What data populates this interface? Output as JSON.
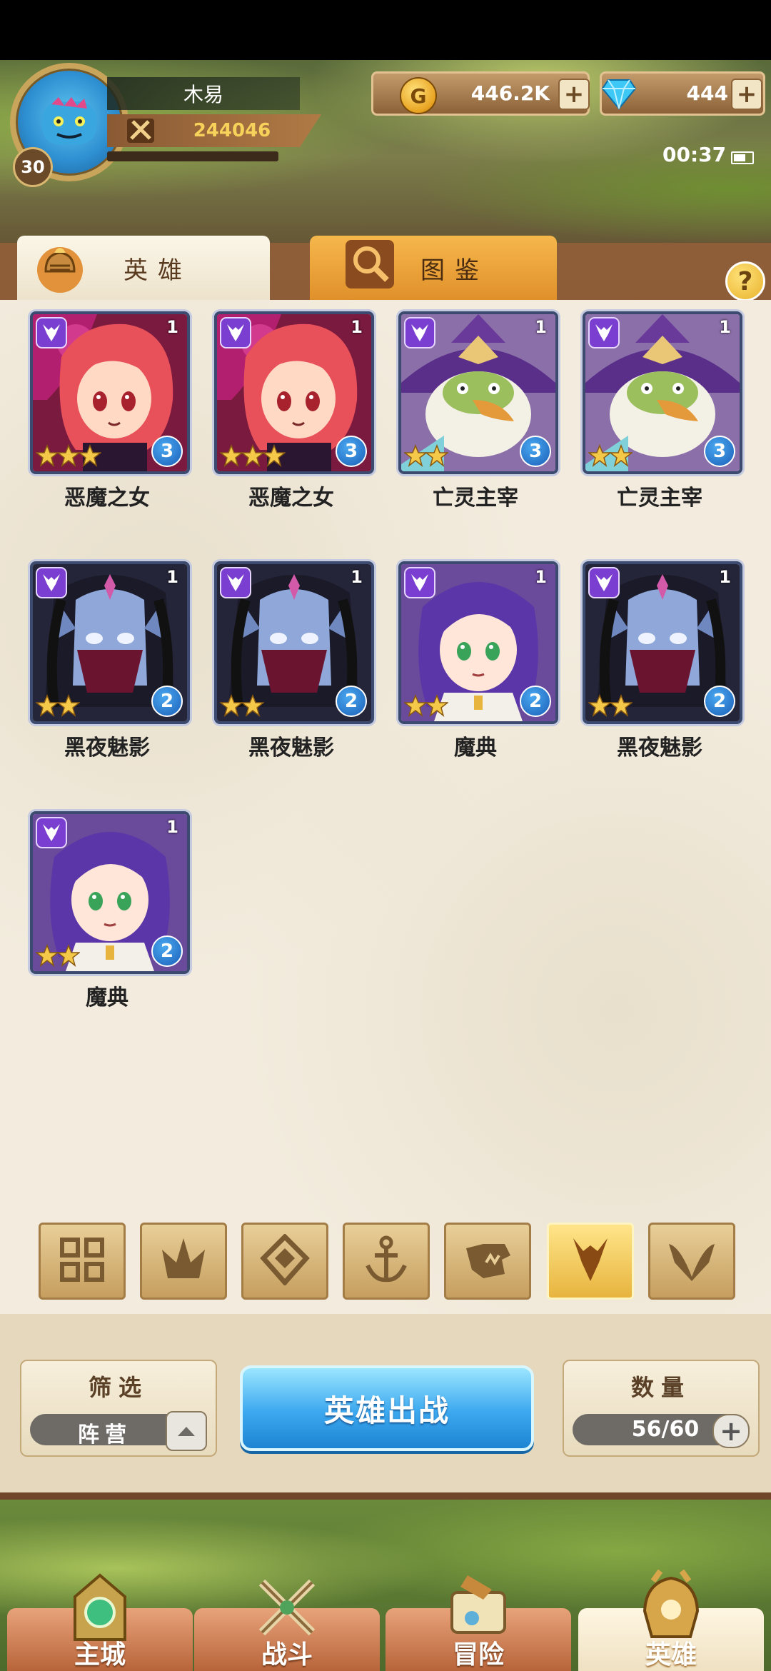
{
  "player": {
    "name": "木易",
    "level": "30",
    "power": "244046"
  },
  "currency": {
    "gold": "446.2K",
    "gems": "444",
    "plus": "+"
  },
  "status": {
    "time": "00:37"
  },
  "tabs": [
    {
      "label": "英雄",
      "icon": "knight-helmet-icon"
    },
    {
      "label": "图鉴",
      "icon": "magnifier-icon"
    }
  ],
  "help": "?",
  "heroes": [
    {
      "name": "恶魔之女",
      "level": "1",
      "stars": 3,
      "grade": "3",
      "faction_icon": "demon-faction-icon",
      "portrait": "red-hair-girl"
    },
    {
      "name": "恶魔之女",
      "level": "1",
      "stars": 3,
      "grade": "3",
      "faction_icon": "demon-faction-icon",
      "portrait": "red-hair-girl"
    },
    {
      "name": "亡灵主宰",
      "level": "1",
      "stars": 2,
      "grade": "3",
      "faction_icon": "demon-faction-icon",
      "portrait": "wizard-goblin"
    },
    {
      "name": "亡灵主宰",
      "level": "1",
      "stars": 2,
      "grade": "3",
      "faction_icon": "demon-faction-icon",
      "portrait": "wizard-goblin"
    },
    {
      "name": "黑夜魅影",
      "level": "1",
      "stars": 2,
      "grade": "2",
      "faction_icon": "demon-faction-icon",
      "portrait": "masked-elf"
    },
    {
      "name": "黑夜魅影",
      "level": "1",
      "stars": 2,
      "grade": "2",
      "faction_icon": "demon-faction-icon",
      "portrait": "masked-elf"
    },
    {
      "name": "魔典",
      "level": "1",
      "stars": 2,
      "grade": "2",
      "faction_icon": "demon-faction-icon",
      "portrait": "purple-hair-girl"
    },
    {
      "name": "黑夜魅影",
      "level": "1",
      "stars": 2,
      "grade": "2",
      "faction_icon": "demon-faction-icon",
      "portrait": "masked-elf"
    },
    {
      "name": "魔典",
      "level": "1",
      "stars": 2,
      "grade": "2",
      "faction_icon": "demon-faction-icon",
      "portrait": "purple-hair-girl"
    }
  ],
  "faction_filters": [
    {
      "icon": "grid-all-icon",
      "selected": false
    },
    {
      "icon": "leaf-faction-icon",
      "selected": false
    },
    {
      "icon": "diamond-faction-icon",
      "selected": false
    },
    {
      "icon": "anchor-faction-icon",
      "selected": false
    },
    {
      "icon": "beast-faction-icon",
      "selected": false
    },
    {
      "icon": "demon-faction-icon",
      "selected": true
    },
    {
      "icon": "wing-faction-icon",
      "selected": false
    }
  ],
  "filter": {
    "title": "筛选",
    "value": "阵营"
  },
  "deploy_button": "英雄出战",
  "count": {
    "title": "数量",
    "value": "56/60"
  },
  "nav": [
    {
      "label": "主城",
      "icon": "castle-icon",
      "active": false
    },
    {
      "label": "战斗",
      "icon": "crossed-swords-icon",
      "active": false
    },
    {
      "label": "冒险",
      "icon": "scroll-map-icon",
      "active": false
    },
    {
      "label": "英雄",
      "icon": "hero-helmet-icon",
      "active": true
    }
  ],
  "colors": {
    "panel_bg": "#f3ecde",
    "frame_brown": "#8e5e39",
    "selected_tab_gold": "#e7b43e",
    "deploy_blue": "#3ca8ef",
    "faction_purple": "#7a3fd0"
  }
}
